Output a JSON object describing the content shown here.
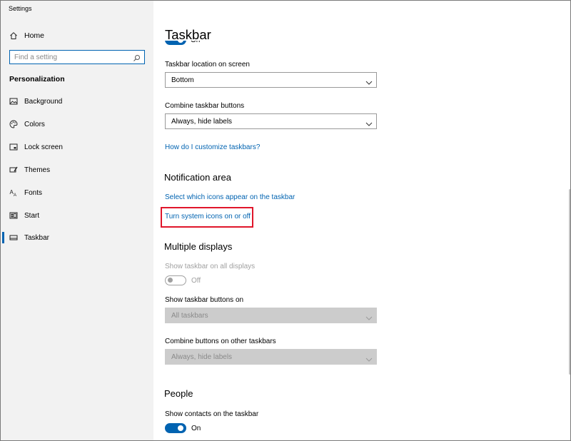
{
  "window": {
    "title": "Settings",
    "controls": {
      "minimize": "—",
      "maximize": "☐",
      "close": "✕"
    }
  },
  "sidebar": {
    "home_label": "Home",
    "search_placeholder": "Find a setting",
    "section_label": "Personalization",
    "items": [
      {
        "label": "Background",
        "icon": "picture-icon"
      },
      {
        "label": "Colors",
        "icon": "palette-icon"
      },
      {
        "label": "Lock screen",
        "icon": "lock-screen-icon"
      },
      {
        "label": "Themes",
        "icon": "themes-brush-icon"
      },
      {
        "label": "Fonts",
        "icon": "fonts-icon"
      },
      {
        "label": "Start",
        "icon": "start-tiles-icon"
      },
      {
        "label": "Taskbar",
        "icon": "taskbar-icon",
        "selected": true
      }
    ]
  },
  "main": {
    "title": "Taskbar",
    "top_toggle_label": "On",
    "taskbar_location": {
      "label": "Taskbar location on screen",
      "value": "Bottom"
    },
    "combine_buttons": {
      "label": "Combine taskbar buttons",
      "value": "Always, hide labels"
    },
    "customize_link": "How do I customize taskbars?",
    "notification_area": {
      "heading": "Notification area",
      "link_icons": "Select which icons appear on the taskbar",
      "link_system_icons": "Turn system icons on or off"
    },
    "multiple_displays": {
      "heading": "Multiple displays",
      "show_all_label": "Show taskbar on all displays",
      "show_all_state": "Off",
      "buttons_on_label": "Show taskbar buttons on",
      "buttons_on_value": "All taskbars",
      "combine_other_label": "Combine buttons on other taskbars",
      "combine_other_value": "Always, hide labels"
    },
    "people": {
      "heading": "People",
      "contacts_label": "Show contacts on the taskbar",
      "contacts_state": "On"
    }
  },
  "colors": {
    "accent": "#0063b1",
    "highlight_box": "#e0162b",
    "sidebar_bg": "#f2f2f2",
    "disabled_dropdown": "#cccccc"
  }
}
